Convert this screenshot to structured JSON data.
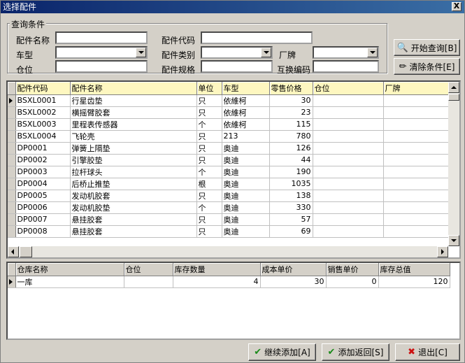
{
  "window": {
    "title": "选择配件",
    "close_label": "X"
  },
  "query": {
    "group_label": "查询条件",
    "part_name_label": "配件名称",
    "part_name_value": "",
    "part_code_label": "配件代码",
    "part_code_value": "",
    "car_model_label": "车型",
    "car_model_value": "",
    "part_category_label": "配件类别",
    "part_category_value": "",
    "brand_label": "厂牌",
    "brand_value": "",
    "location_label": "仓位",
    "location_value": "",
    "spec_label": "配件规格",
    "spec_value": "",
    "interchange_label": "互换编码",
    "interchange_value": ""
  },
  "buttons": {
    "search": "开始查询[B]",
    "clear": "清除条件[E]",
    "continue_add": "继续添加[A]",
    "add_return": "添加返回[S]",
    "exit": "退出[C]"
  },
  "parts_table": {
    "headers": [
      "配件代码",
      "配件名称",
      "单位",
      "车型",
      "零售价格",
      "仓位",
      "厂牌"
    ],
    "rows": [
      [
        "BSXL0001",
        "行星齿垫",
        "只",
        "依維柯",
        "30",
        "",
        ""
      ],
      [
        "BSXL0002",
        "横摇臂胶套",
        "只",
        "依維柯",
        "23",
        "",
        ""
      ],
      [
        "BSXL0003",
        "里程表传感器",
        "个",
        "依維柯",
        "115",
        "",
        ""
      ],
      [
        "BSXL0004",
        "飞轮壳",
        "只",
        "213",
        "780",
        "",
        ""
      ],
      [
        "DP0001",
        "弹簧上隔垫",
        "只",
        "奥迪",
        "126",
        "",
        ""
      ],
      [
        "DP0002",
        "引擎胶垫",
        "只",
        "奥迪",
        "44",
        "",
        ""
      ],
      [
        "DP0003",
        "拉杆球头",
        "个",
        "奥迪",
        "190",
        "",
        ""
      ],
      [
        "DP0004",
        "后桥止推垫",
        "根",
        "奥迪",
        "1035",
        "",
        ""
      ],
      [
        "DP0005",
        "发动机胶套",
        "只",
        "奥迪",
        "138",
        "",
        ""
      ],
      [
        "DP0006",
        "发动机胶垫",
        "个",
        "奥迪",
        "330",
        "",
        ""
      ],
      [
        "DP0007",
        "悬挂胶套",
        "只",
        "奥迪",
        "57",
        "",
        ""
      ],
      [
        "DP0008",
        "悬挂胶套",
        "只",
        "奥迪",
        "69",
        "",
        ""
      ]
    ]
  },
  "stock_table": {
    "headers": [
      "仓库名称",
      "仓位",
      "库存数量",
      "成本单价",
      "销售单价",
      "库存总值"
    ],
    "rows": [
      [
        "一库",
        "",
        "4",
        "30",
        "0",
        "120"
      ]
    ]
  },
  "colors": {
    "header_highlight": "#fef7c0",
    "titlebar": "#0a246a"
  }
}
